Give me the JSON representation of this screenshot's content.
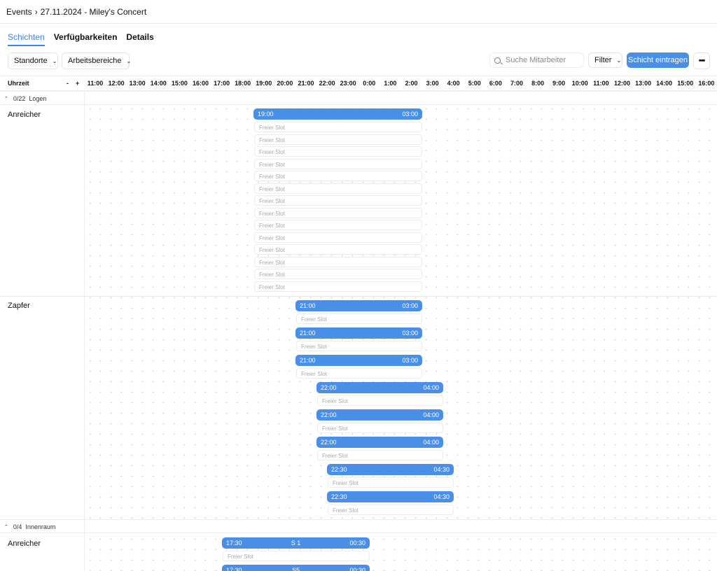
{
  "breadcrumb": {
    "parent": "Events",
    "separator": "›",
    "current": "27.11.2024 - Miley's Concert"
  },
  "tabs": [
    {
      "label": "Schichten",
      "active": true
    },
    {
      "label": "Verfügbarkeiten",
      "active": false
    },
    {
      "label": "Details",
      "active": false
    }
  ],
  "toolbar": {
    "locations_label": "Standorte",
    "areas_label": "Arbeitsbereiche",
    "search_placeholder": "Suche Mitarbeiter",
    "filter_label": "Filter",
    "add_shift_label": "Schicht eintragen",
    "more_label": "•••"
  },
  "timeline": {
    "header_label": "Uhrzeit",
    "zoom_out": "-",
    "zoom_in": "+",
    "hours": [
      "11:00",
      "12:00",
      "13:00",
      "14:00",
      "15:00",
      "16:00",
      "17:00",
      "18:00",
      "19:00",
      "20:00",
      "21:00",
      "22:00",
      "23:00",
      "0:00",
      "1:00",
      "2:00",
      "3:00",
      "4:00",
      "5:00",
      "6:00",
      "7:00",
      "8:00",
      "9:00",
      "10:00",
      "11:00",
      "12:00",
      "13:00",
      "14:00",
      "15:00",
      "16:00"
    ]
  },
  "free_slot_label": "Freier Slot",
  "sections": [
    {
      "count": "0/22",
      "name": "Logen",
      "rows": [
        {
          "label": "Anreicher"
        },
        {
          "label": "Zapfer"
        }
      ]
    },
    {
      "count": "0/4",
      "name": "Innenraum",
      "rows": [
        {
          "label": "Anreicher"
        }
      ]
    }
  ],
  "shifts": [
    {
      "start": "19:00",
      "end": "03:00",
      "name": "",
      "free_slots": 14
    },
    {
      "start": "21:00",
      "end": "03:00",
      "name": "",
      "free_slots": 1
    },
    {
      "start": "21:00",
      "end": "03:00",
      "name": "",
      "free_slots": 1
    },
    {
      "start": "21:00",
      "end": "03:00",
      "name": "",
      "free_slots": 1
    },
    {
      "start": "22:00",
      "end": "04:00",
      "name": "",
      "free_slots": 1
    },
    {
      "start": "22:00",
      "end": "04:00",
      "name": "",
      "free_slots": 1
    },
    {
      "start": "22:00",
      "end": "04:00",
      "name": "",
      "free_slots": 1
    },
    {
      "start": "22:30",
      "end": "04:30",
      "name": "",
      "free_slots": 1
    },
    {
      "start": "22:30",
      "end": "04:30",
      "name": "",
      "free_slots": 1
    },
    {
      "start": "17:30",
      "end": "00:30",
      "name": "S 1",
      "free_slots": 1
    },
    {
      "start": "17:30",
      "end": "00:30",
      "name": "S5",
      "free_slots": 0
    }
  ],
  "colors": {
    "accent": "#4a8fe7",
    "tab_active": "#3b82f6"
  },
  "icons": {
    "breadcrumb_separator": "chevron-right-icon",
    "dropdown": "chevron-down-icon",
    "search": "search-icon",
    "collapse": "chevron-up-icon",
    "more": "more-horizontal-icon"
  }
}
